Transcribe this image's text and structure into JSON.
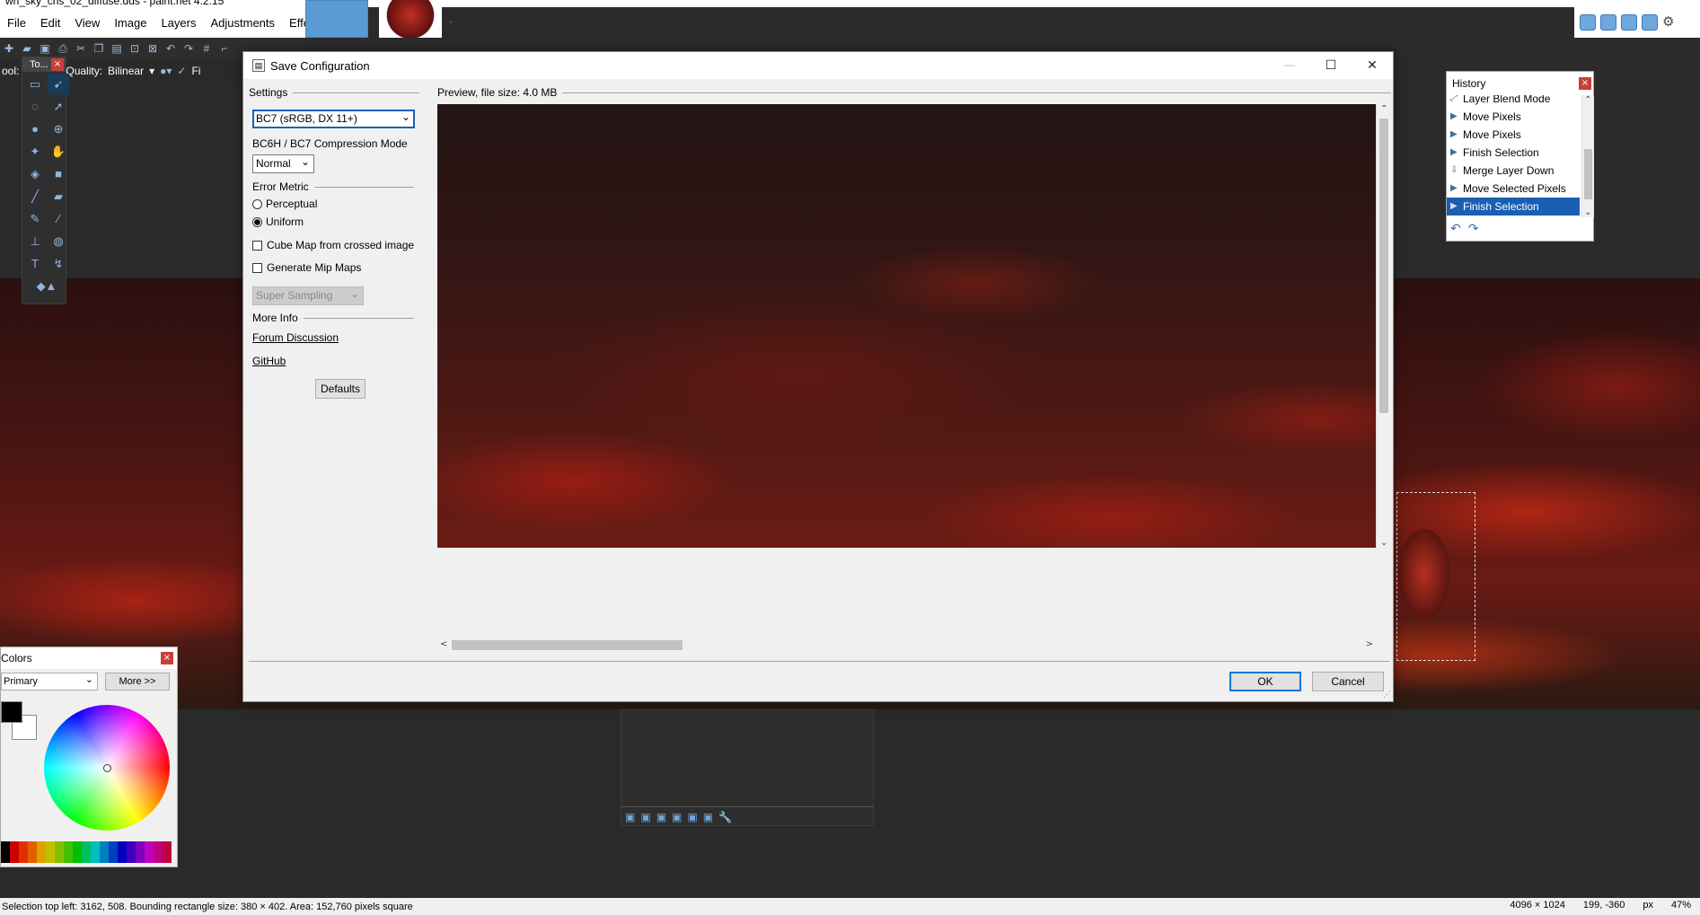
{
  "app": {
    "title": "wh_sky_chs_02_diffuse.dds - paint.net 4.2.15",
    "menu": [
      "File",
      "Edit",
      "View",
      "Image",
      "Layers",
      "Adjustments",
      "Effects"
    ]
  },
  "toolbar2": {
    "tool_label": "ool:",
    "quality_label": "Quality:",
    "quality_value": "Bilinear",
    "finish_label": "Fi"
  },
  "tools_panel": {
    "title": "To..."
  },
  "colors_panel": {
    "title": "Colors",
    "mode": "Primary",
    "more_button": "More >>",
    "primary_color": "#000000",
    "secondary_color": "#ffffff"
  },
  "history": {
    "title": "History",
    "items": [
      {
        "label": "Layer Blend Mode",
        "icon": "layer-blend-icon"
      },
      {
        "label": "Move Pixels",
        "icon": "move-pixels-icon"
      },
      {
        "label": "Move Pixels",
        "icon": "move-pixels-icon"
      },
      {
        "label": "Finish Selection",
        "icon": "finish-selection-icon"
      },
      {
        "label": "Merge Layer Down",
        "icon": "merge-layer-icon"
      },
      {
        "label": "Move Selected Pixels",
        "icon": "move-pixels-icon"
      },
      {
        "label": "Finish Selection",
        "icon": "finish-selection-icon",
        "selected": true
      }
    ]
  },
  "dialog": {
    "title": "Save Configuration",
    "settings_label": "Settings",
    "format": "BC7 (sRGB, DX 11+)",
    "compression_mode_label": "BC6H / BC7 Compression Mode",
    "compression_mode": "Normal",
    "error_metric_label": "Error Metric",
    "error_metric_options": [
      "Perceptual",
      "Uniform"
    ],
    "error_metric_selected": "Uniform",
    "cube_map_label": "Cube Map from crossed image",
    "mip_maps_label": "Generate Mip Maps",
    "sampling": "Super Sampling",
    "more_info_label": "More Info",
    "forum_link": "Forum Discussion",
    "github_link": "GitHub",
    "defaults_button": "Defaults",
    "preview_label": "Preview, file size: 4.0 MB",
    "ok_button": "OK",
    "cancel_button": "Cancel"
  },
  "status": {
    "selection": "Selection top left: 3162, 508. Bounding rectangle size: 380 × 402. Area: 152,760 pixels square",
    "image_size": "4096 × 1024",
    "cursor": "199, -360",
    "unit": "px",
    "zoom": "47%"
  }
}
